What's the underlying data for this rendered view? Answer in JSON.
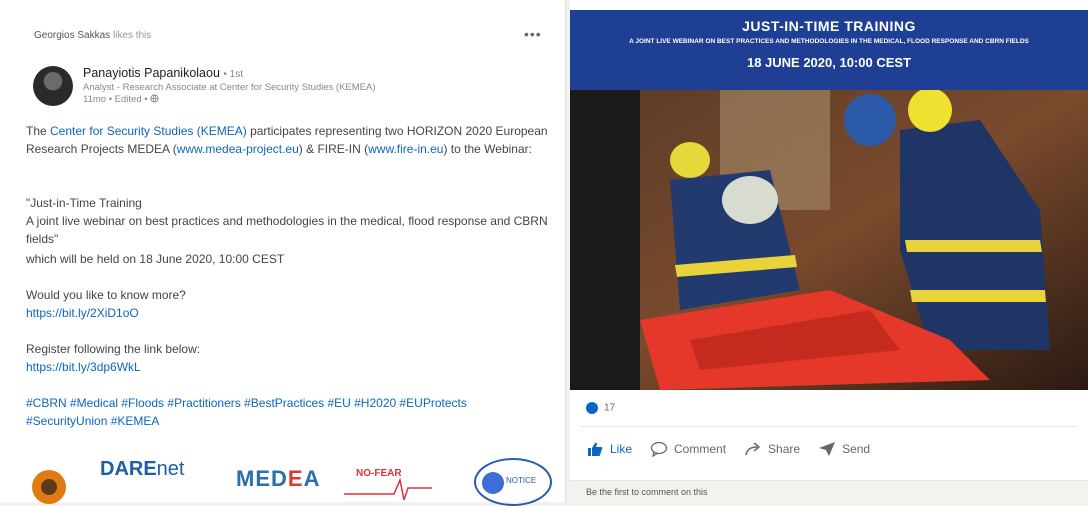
{
  "activity": {
    "name": "Georgios Sakkas",
    "action": "likes this"
  },
  "more_label": "•••",
  "author": {
    "name": "Panayiotis Papanikolaou",
    "degree": "• 1st",
    "headline": "Analyst - Research Associate at Center for Security Studies (KEMEA)",
    "timeline": "11mo • Edited • "
  },
  "post": {
    "p1_a": "The ",
    "p1_org": "Center for Security Studies (KEMEA)",
    "p1_b": " participates representing two HORIZON 2020 European Research Projects MEDEA (",
    "p1_link1": "www.medea-project.eu",
    "p1_c": ") & FIRE-IN (",
    "p1_link2": "www.fire-in.eu",
    "p1_d": ") to the Webinar:",
    "p2_line1": "\"Just-in-Time Training",
    "p2_line2": "A joint live webinar on best practices and methodologies in the medical, flood response and CBRN fields\"",
    "p3": "which will be held on 18 June 2020, 10:00 CEST",
    "p4_text": "Would you like to know more?",
    "p4_link": "https://bit.ly/2XiD1oO",
    "p5_text": "Register following the link below:",
    "p5_link": "https://bit.ly/3dp6WkL",
    "hashtags": "#CBRN #Medical #Floods #Practitioners #BestPractices #EU #H2020 #EUProtects #SecurityUnion #KEMEA"
  },
  "logos": {
    "dare": "DARE",
    "dare_net": "net",
    "medea_a": "MED",
    "medea_e": "E",
    "medea_b": "A",
    "nofear": "NO-FEAR",
    "notice": "NOTICE"
  },
  "banner": {
    "title": "JUST-IN-TIME TRAINING",
    "subtitle": "A JOINT LIVE WEBINAR ON BEST PRACTICES AND METHODOLOGIES IN THE MEDICAL, FLOOD RESPONSE AND CBRN FIELDS",
    "date": "18 JUNE 2020, 10:00 CEST"
  },
  "reactions": {
    "count": "17"
  },
  "actions": {
    "like": "Like",
    "comment": "Comment",
    "share": "Share",
    "send": "Send"
  },
  "footer": {
    "text": "Be the first to comment on this"
  },
  "colors": {
    "link": "#0a66c2",
    "banner": "#1f3f95",
    "accent_orange": "#e07a12",
    "medea_red": "#d83a2b"
  }
}
